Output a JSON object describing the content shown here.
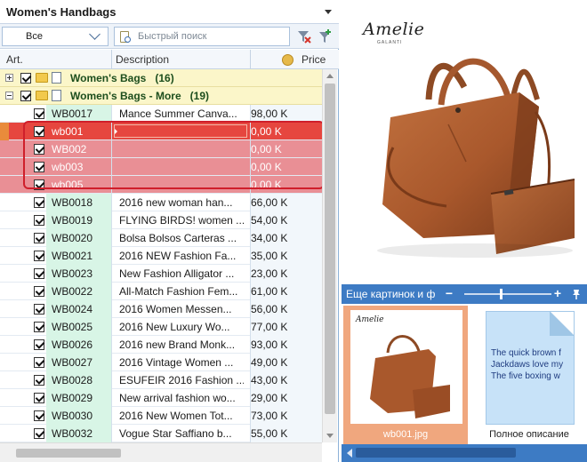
{
  "panel": {
    "title": "Women's Handbags"
  },
  "filter": {
    "select_value": "Все",
    "search_placeholder": "Быстрый поиск"
  },
  "columns": {
    "art": "Art.",
    "description": "Description",
    "price": "Price"
  },
  "groups": [
    {
      "label": "Women's Bags",
      "count": "(16)",
      "expanded": false
    },
    {
      "label": "Women's Bags - More",
      "count": "(19)",
      "expanded": true
    }
  ],
  "rows": [
    {
      "art": "WB0017",
      "desc": "Mance Summer Canva...",
      "price": "98,00 K"
    },
    {
      "art": "wb001",
      "desc": "",
      "price": "0,00 K"
    },
    {
      "art": "WB002",
      "desc": "",
      "price": "0,00 K"
    },
    {
      "art": "wb003",
      "desc": "",
      "price": "0,00 K"
    },
    {
      "art": "wb005",
      "desc": "",
      "price": "0,00 K"
    },
    {
      "art": "WB0018",
      "desc": "2016 new woman han...",
      "price": "66,00 K"
    },
    {
      "art": "WB0019",
      "desc": "FLYING BIRDS! women ...",
      "price": "54,00 K"
    },
    {
      "art": "WB0020",
      "desc": "Bolsa Bolsos Carteras ...",
      "price": "34,00 K"
    },
    {
      "art": "WB0021",
      "desc": "2016 NEW Fashion Fa...",
      "price": "35,00 K"
    },
    {
      "art": "WB0023",
      "desc": "New Fashion Alligator ...",
      "price": "23,00 K"
    },
    {
      "art": "WB0022",
      "desc": "All-Match Fashion Fem...",
      "price": "61,00 K"
    },
    {
      "art": "WB0024",
      "desc": "2016 Women Messen...",
      "price": "56,00 K"
    },
    {
      "art": "WB0025",
      "desc": "2016 New Luxury Wo...",
      "price": "77,00 K"
    },
    {
      "art": "WB0026",
      "desc": "2016 new Brand Monk...",
      "price": "93,00 K"
    },
    {
      "art": "WB0027",
      "desc": "2016 Vintage Women ...",
      "price": "49,00 K"
    },
    {
      "art": "WB0028",
      "desc": "ESUFEIR 2016 Fashion ...",
      "price": "43,00 K"
    },
    {
      "art": "WB0029",
      "desc": "New arrival fashion wo...",
      "price": "29,00 K"
    },
    {
      "art": "WB0030",
      "desc": "2016 New Women Tot...",
      "price": "73,00 K"
    },
    {
      "art": "WB0032",
      "desc": "Vogue Star Saffiano b...",
      "price": "55,00 K"
    }
  ],
  "preview": {
    "brand": "Amelie",
    "brand_sub": "GALANTI"
  },
  "strip": {
    "label": "Еще картинок и ф",
    "zoom_out": "−",
    "zoom_in": "+",
    "zoom_level": 0.42
  },
  "thumbnails": [
    {
      "caption": "wb001.jpg",
      "selected": true,
      "brand": "Amelie"
    },
    {
      "caption": "Полное описание",
      "selected": false,
      "text_lines": [
        "The quick brown f",
        "Jackdaws love my",
        "The five boxing w"
      ]
    }
  ],
  "colors": {
    "accent": "#3d7bc4",
    "selection_red": "#e98f95",
    "current_row": "#e6463f",
    "group_bg": "#fbf6c9",
    "art_bg": "#d8f5e6",
    "leather": "#a9582c"
  }
}
